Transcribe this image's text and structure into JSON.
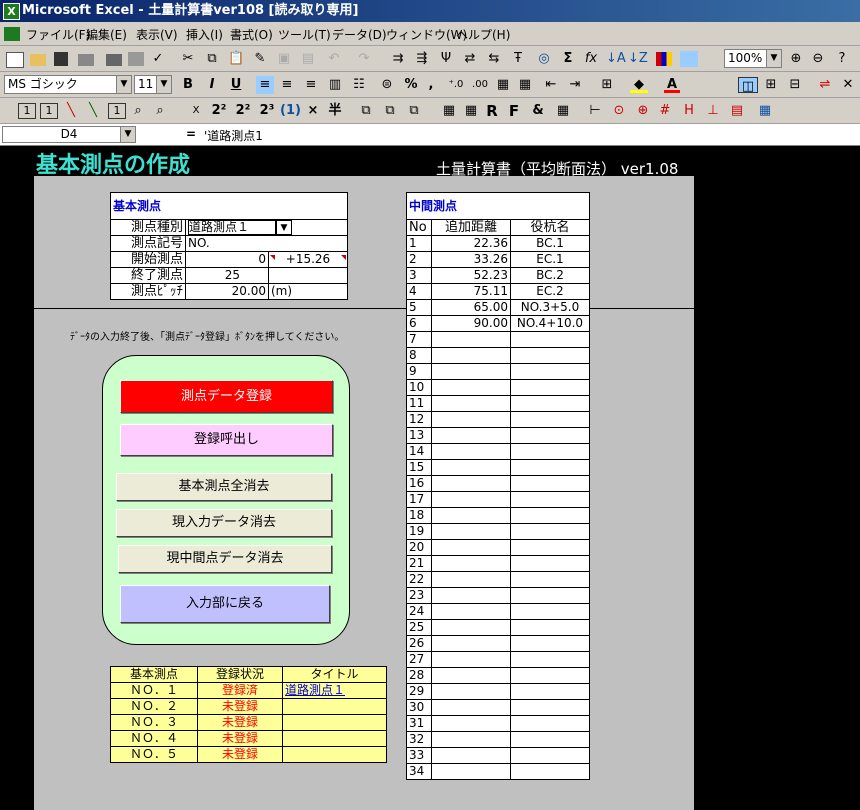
{
  "window": {
    "title": "Microsoft Excel - 土量計算書ver108 [読み取り専用]",
    "app_icon": "X"
  },
  "menu": [
    "ファイル(F)",
    "編集(E)",
    "表示(V)",
    "挿入(I)",
    "書式(O)",
    "ツール(T)",
    "データ(D)",
    "ウィンドウ(W)",
    "ヘルプ(H)"
  ],
  "toolbar": {
    "zoom": "100%",
    "font": "MS ゴシック",
    "size": "11",
    "sym_sum": "Σ",
    "sym_fx": "fx",
    "sym_pct": "%",
    "sym_comma": ",",
    "bold": "B",
    "italic": "I",
    "underline": "U",
    "sheet_btns": [
      "1",
      "1",
      "1",
      "X",
      "2²",
      "2²",
      "2³",
      "(1)",
      "×",
      "半",
      "R",
      "F",
      "&"
    ]
  },
  "formula_bar": {
    "cell_ref": "D4",
    "eq": "=",
    "value": "'道路測点1"
  },
  "sheet": {
    "title": "基本測点の作成",
    "subtitle": "土量計算書（平均断面法） ver1.08",
    "basic": {
      "header": "基本測点",
      "rows": [
        {
          "label": "測点種別",
          "value": "道路測点１",
          "extra": ""
        },
        {
          "label": "測点記号",
          "value": "NO.",
          "extra": ""
        },
        {
          "label": "開始測点",
          "value": "0",
          "extra": "+15.26"
        },
        {
          "label": "終了測点",
          "value": "25",
          "extra": ""
        },
        {
          "label": "測点ﾋﾟｯﾁ",
          "value": "20.00",
          "extra": "(m)"
        }
      ]
    },
    "instruction": "ﾃﾞｰﾀの入力終了後、「測点ﾃﾞｰﾀ登録」ﾎﾞﾀﾝを押してください。",
    "buttons": {
      "register": "測点データ登録",
      "recall": "登録呼出し",
      "clear_basic": "基本測点全消去",
      "clear_input": "現入力データ消去",
      "clear_mid": "現中間点データ消去",
      "back": "入力部に戻る"
    },
    "status_table": {
      "headers": [
        "基本測点",
        "登録状況",
        "タイトル"
      ],
      "rows": [
        {
          "no": "ＮＯ．１",
          "status": "登録済",
          "title": "道路測点１"
        },
        {
          "no": "ＮＯ．２",
          "status": "未登録",
          "title": ""
        },
        {
          "no": "ＮＯ．３",
          "status": "未登録",
          "title": ""
        },
        {
          "no": "ＮＯ．４",
          "status": "未登録",
          "title": ""
        },
        {
          "no": "ＮＯ．５",
          "status": "未登録",
          "title": ""
        }
      ]
    },
    "mid": {
      "header": "中間測点",
      "col_no": "No",
      "col_dist": "追加距離",
      "col_name": "役杭名",
      "rows": [
        {
          "no": "1",
          "dist": "22.36",
          "name": "BC.1"
        },
        {
          "no": "2",
          "dist": "33.26",
          "name": "EC.1"
        },
        {
          "no": "3",
          "dist": "52.23",
          "name": "BC.2"
        },
        {
          "no": "4",
          "dist": "75.11",
          "name": "EC.2"
        },
        {
          "no": "5",
          "dist": "65.00",
          "name": "NO.3+5.0"
        },
        {
          "no": "6",
          "dist": "90.00",
          "name": "NO.4+10.0"
        },
        {
          "no": "7",
          "dist": "",
          "name": ""
        },
        {
          "no": "8",
          "dist": "",
          "name": ""
        },
        {
          "no": "9",
          "dist": "",
          "name": ""
        },
        {
          "no": "10",
          "dist": "",
          "name": ""
        },
        {
          "no": "11",
          "dist": "",
          "name": ""
        },
        {
          "no": "12",
          "dist": "",
          "name": ""
        },
        {
          "no": "13",
          "dist": "",
          "name": ""
        },
        {
          "no": "14",
          "dist": "",
          "name": ""
        },
        {
          "no": "15",
          "dist": "",
          "name": ""
        },
        {
          "no": "16",
          "dist": "",
          "name": ""
        },
        {
          "no": "17",
          "dist": "",
          "name": ""
        },
        {
          "no": "18",
          "dist": "",
          "name": ""
        },
        {
          "no": "19",
          "dist": "",
          "name": ""
        },
        {
          "no": "20",
          "dist": "",
          "name": ""
        },
        {
          "no": "21",
          "dist": "",
          "name": ""
        },
        {
          "no": "22",
          "dist": "",
          "name": ""
        },
        {
          "no": "23",
          "dist": "",
          "name": ""
        },
        {
          "no": "24",
          "dist": "",
          "name": ""
        },
        {
          "no": "25",
          "dist": "",
          "name": ""
        },
        {
          "no": "26",
          "dist": "",
          "name": ""
        },
        {
          "no": "27",
          "dist": "",
          "name": ""
        },
        {
          "no": "28",
          "dist": "",
          "name": ""
        },
        {
          "no": "29",
          "dist": "",
          "name": ""
        },
        {
          "no": "30",
          "dist": "",
          "name": ""
        },
        {
          "no": "31",
          "dist": "",
          "name": ""
        },
        {
          "no": "32",
          "dist": "",
          "name": ""
        },
        {
          "no": "33",
          "dist": "",
          "name": ""
        },
        {
          "no": "34",
          "dist": "",
          "name": ""
        }
      ]
    }
  },
  "colors": {
    "title_cyan": "#40e0d0",
    "btn_red": "#ff0000",
    "btn_pink": "#ffccff",
    "btn_blue": "#c0c0ff",
    "panel_green": "#ccffcc",
    "table_yellow": "#ffff99",
    "status_red": "#ff0000"
  }
}
